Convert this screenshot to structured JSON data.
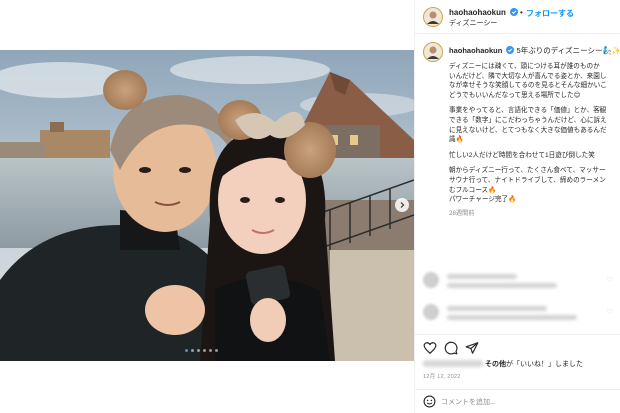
{
  "header": {
    "username": "haohaohaokun",
    "follow_separator": "•",
    "follow_label": "フォローする",
    "location": "ディズニーシー"
  },
  "caption": {
    "username": "haohaohaokun",
    "title": "5年ぶりのディズニーシー🧞✨",
    "lines": [
      "ディズニーには疎くて、頭につける耳が誰のものか",
      "いんだけど、隣で大切な人が喜んでる姿とか、来園し",
      "なが幸せそうな笑顔してるのを見るとそんな細かいこ",
      "どうでもいいんだなって思える場所でした😊",
      "",
      "事業をやってると、言語化できる「価値」とか、客観",
      "できる「数字」にこだわっちゃうんだけど、心に訴え",
      "に見えないけど、とてつもなく大きな価値もあるんだ",
      "識🔥",
      "",
      "忙しい2人だけど時間を合わせて1日遊び倒した笑",
      "",
      "朝からディズニー行って、たくさん食べて、マッサー",
      "サウナ行って、ナイトドライブして、締めのラーメン",
      "むフルコース🔥",
      "パワーチャージ完了🔥"
    ],
    "time_ago": "28週間前"
  },
  "likes": {
    "others": "その他",
    "suffix": "が「いいね！」しました"
  },
  "post_date": "12月 12, 2022",
  "comment_box": {
    "placeholder": "コメントを追加..."
  },
  "media": {
    "slide_count": 6,
    "active_slide": 1
  },
  "colors": {
    "link_blue": "#0095f6",
    "verified_blue": "#3897f0",
    "muted_gray": "#8e8e8e",
    "text": "#262626"
  },
  "icons": {
    "like": "heart-icon",
    "comment": "comment-icon",
    "share": "paper-plane-icon",
    "emoji": "smiley-icon",
    "next": "chevron-right-icon",
    "verified": "verified-badge-icon"
  }
}
